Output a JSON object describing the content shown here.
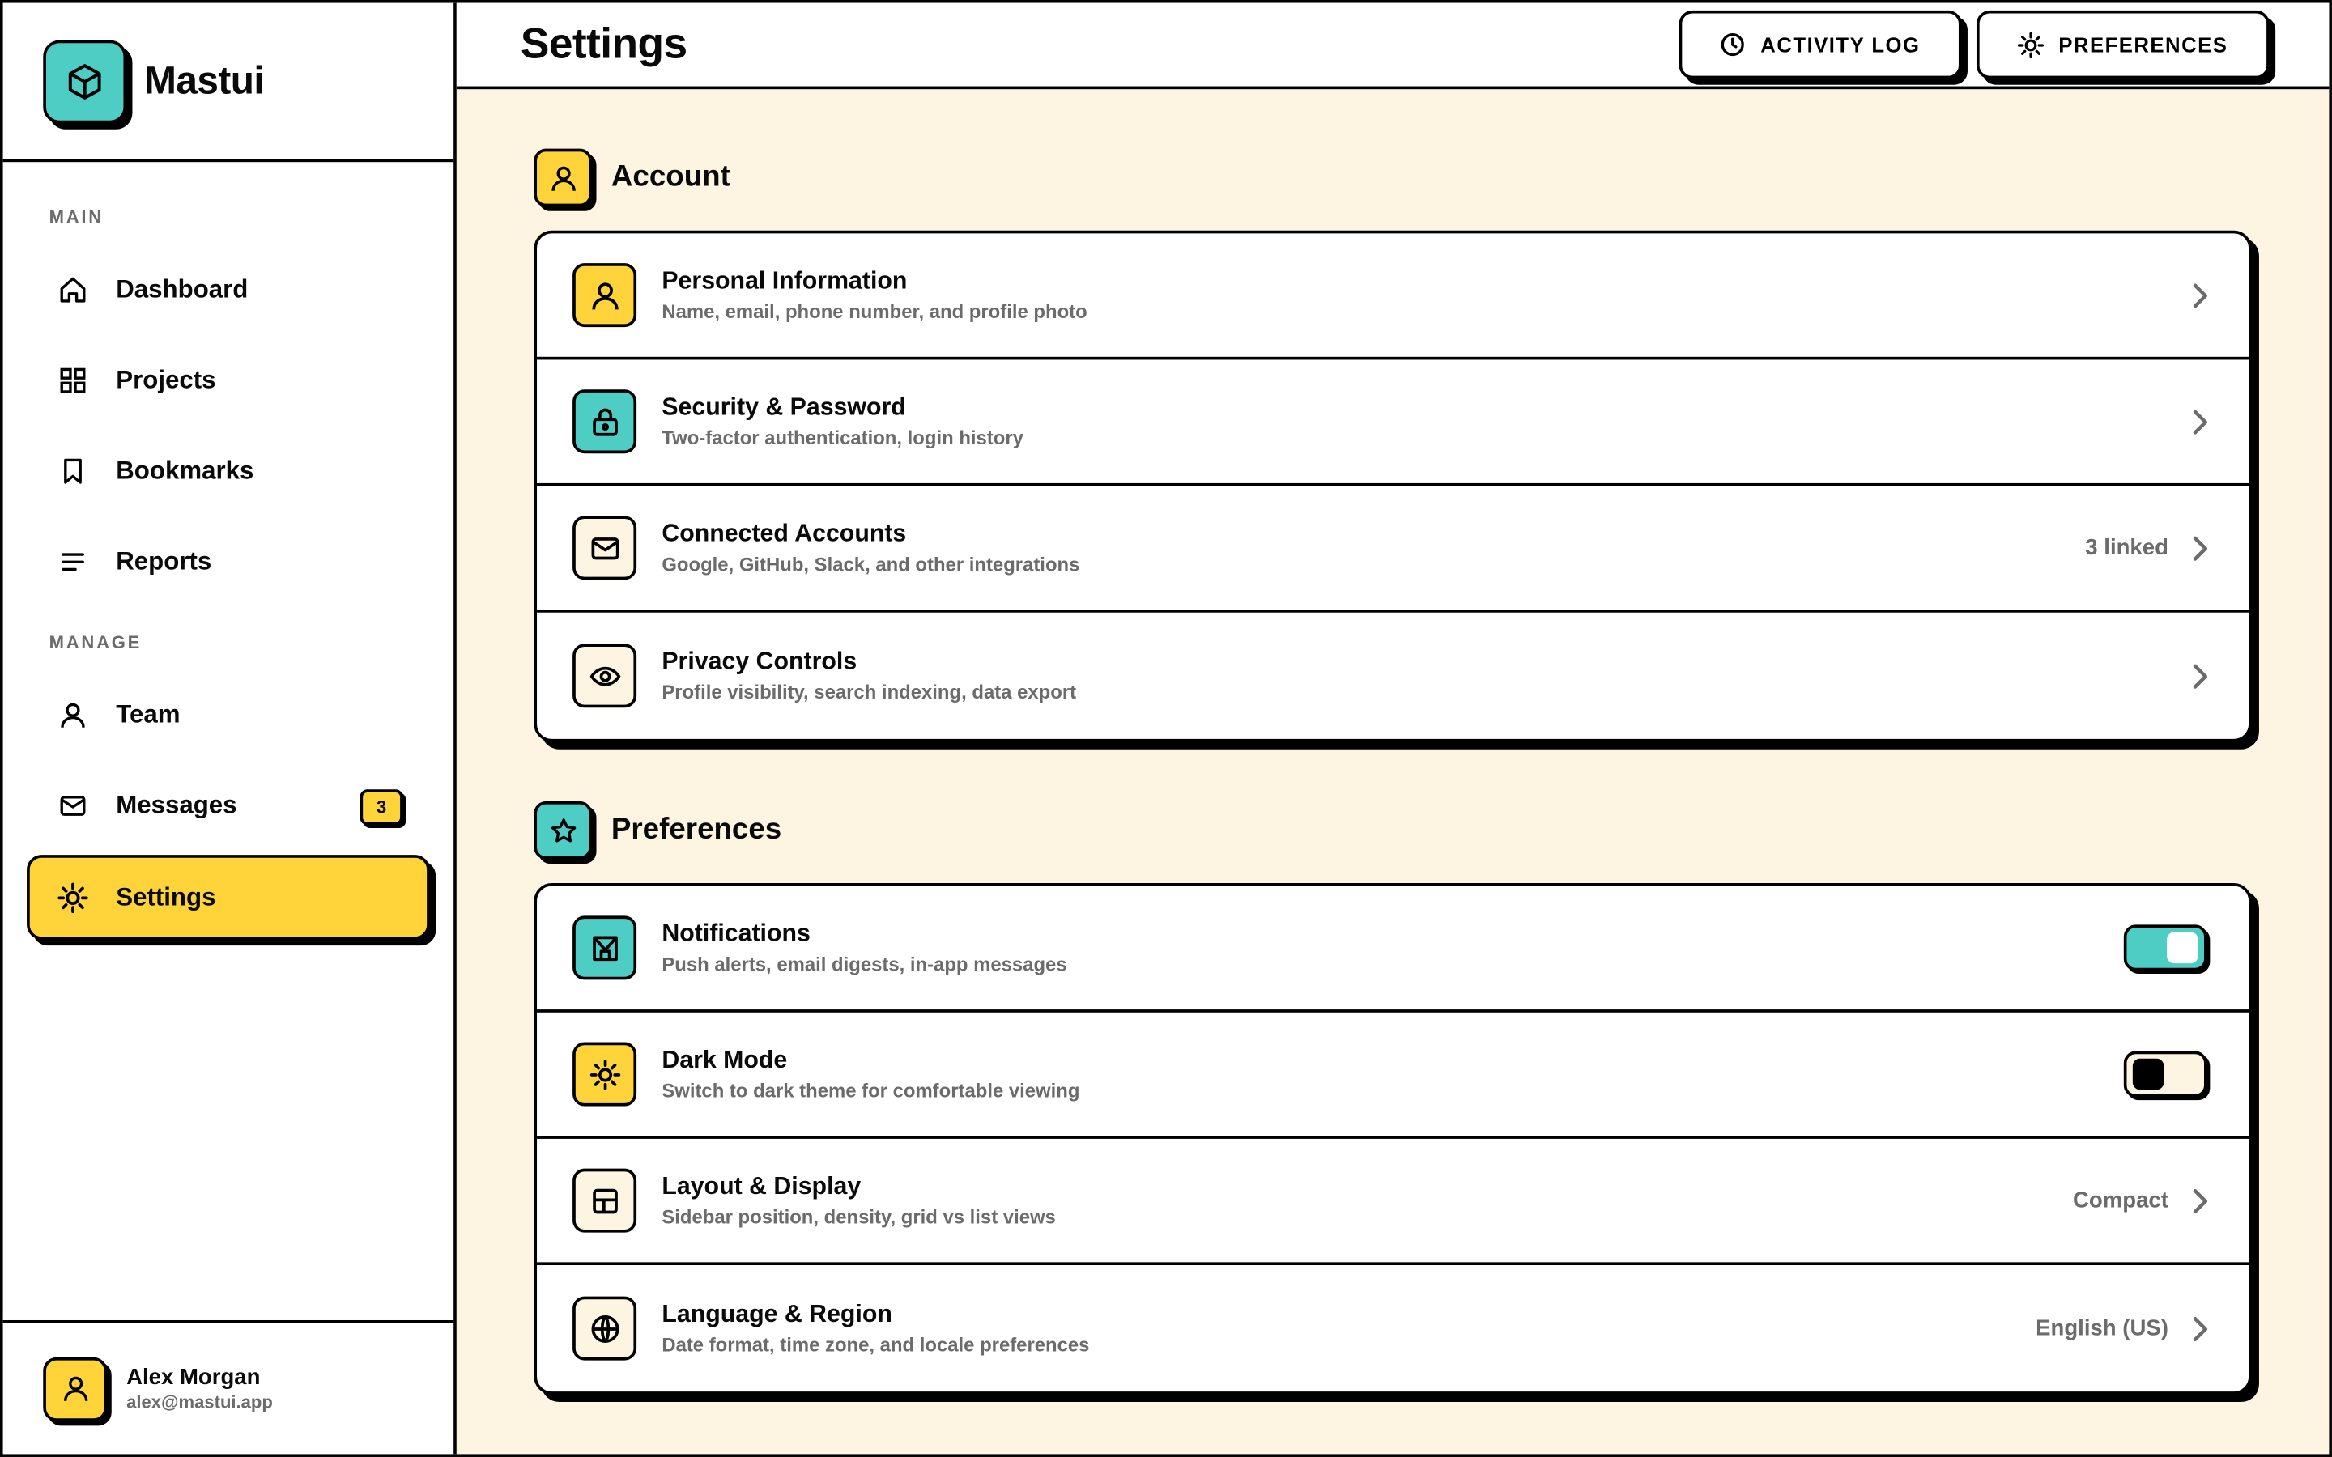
{
  "brand": {
    "name": "Mastui",
    "icon": "cube-icon"
  },
  "sidebar": {
    "sections": [
      {
        "label": "MAIN"
      },
      {
        "label": "MANAGE"
      }
    ],
    "items": [
      {
        "label": "Dashboard",
        "icon": "home-icon"
      },
      {
        "label": "Projects",
        "icon": "grid-icon"
      },
      {
        "label": "Bookmarks",
        "icon": "bookmark-icon"
      },
      {
        "label": "Reports",
        "icon": "lines-icon"
      },
      {
        "label": "Team",
        "icon": "user-icon"
      },
      {
        "label": "Messages",
        "icon": "mail-icon",
        "badge": "3"
      },
      {
        "label": "Settings",
        "icon": "gear-icon",
        "active": true
      }
    ]
  },
  "user": {
    "name": "Alex Morgan",
    "email": "alex@mastui.app"
  },
  "header": {
    "title": "Settings",
    "activity_label": "ACTIVITY LOG",
    "preferences_label": "PREFERENCES"
  },
  "account": {
    "title": "Account",
    "rows": [
      {
        "title": "Personal Information",
        "desc": "Name, email, phone number, and profile photo",
        "icon": "user-icon"
      },
      {
        "title": "Security & Password",
        "desc": "Two-factor authentication, login history",
        "icon": "lock-icon"
      },
      {
        "title": "Connected Accounts",
        "desc": "Google, GitHub, Slack, and other integrations",
        "value": "3 linked",
        "icon": "mail-icon"
      },
      {
        "title": "Privacy Controls",
        "desc": "Profile visibility, search indexing, data export",
        "icon": "eye-icon"
      }
    ]
  },
  "preferences": {
    "title": "Preferences",
    "rows": [
      {
        "title": "Notifications",
        "desc": "Push alerts, email digests, in-app messages",
        "toggle": true,
        "icon": "inbox-icon"
      },
      {
        "title": "Dark Mode",
        "desc": "Switch to dark theme for comfortable viewing",
        "toggle": false,
        "icon": "sun-icon"
      },
      {
        "title": "Layout & Display",
        "desc": "Sidebar position, density, grid vs list views",
        "value": "Compact",
        "icon": "layout-icon"
      },
      {
        "title": "Language & Region",
        "desc": "Date format, time zone, and locale preferences",
        "value": "English (US)",
        "icon": "globe-icon"
      }
    ]
  },
  "colors": {
    "yellow": "#ffd43b",
    "teal": "#4ecdc4",
    "cream": "#fdf5e2",
    "muted": "#6b6b6b"
  }
}
